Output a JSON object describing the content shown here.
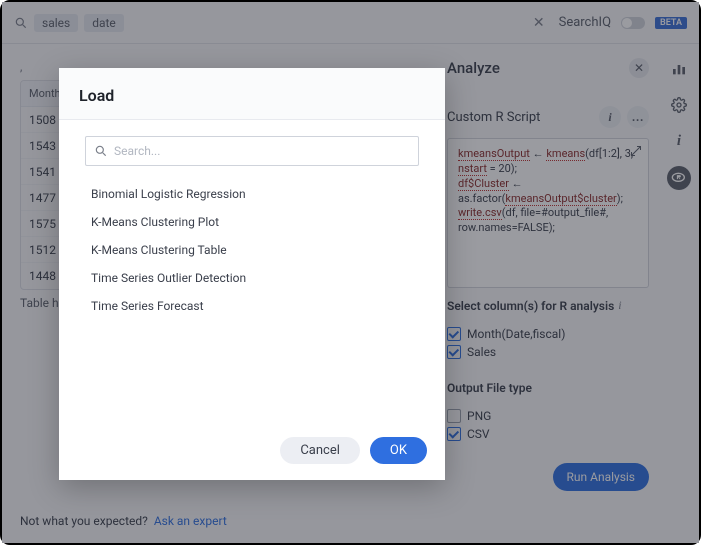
{
  "search": {
    "chip1": "sales",
    "chip2": "date",
    "placeholder": "",
    "searchiq_label": "SearchIQ",
    "beta_label": "BETA"
  },
  "table": {
    "header": "Month",
    "rows": [
      "1508",
      "1543",
      "1541",
      "1477",
      "1575",
      "1512",
      "1448"
    ],
    "caption": "Table h",
    "caret": ","
  },
  "analyze": {
    "title": "Analyze",
    "script_title": "Custom R Script",
    "code_parts": {
      "p1": "kmeansOutput",
      "arrow": " ← ",
      "p2": "kmeans",
      "p3": "(df[1:2], 3, ",
      "p4": "nstart",
      "p5": " = 20);",
      "p6": "df$Cluster",
      "p7": " ← as.factor(",
      "p8": "kmeansOutput$cluster",
      "p9": ");",
      "p10": "write.csv",
      "p11": "(df, file=#output_file#, row.names=FALSE);"
    },
    "select_cols_label": "Select column(s) for R analysis",
    "col1": "Month(Date,fiscal)",
    "col2": "Sales",
    "output_label": "Output File type",
    "out1": "PNG",
    "out2": "CSV",
    "run_label": "Run Analysis"
  },
  "footer": {
    "text": "Not what you expected?",
    "link": "Ask an expert"
  },
  "modal": {
    "title": "Load",
    "search_placeholder": "Search...",
    "items": [
      "Binomial Logistic Regression",
      "K-Means Clustering Plot",
      "K-Means Clustering Table",
      "Time Series Outlier Detection",
      "Time Series Forecast"
    ],
    "cancel": "Cancel",
    "ok": "OK"
  }
}
